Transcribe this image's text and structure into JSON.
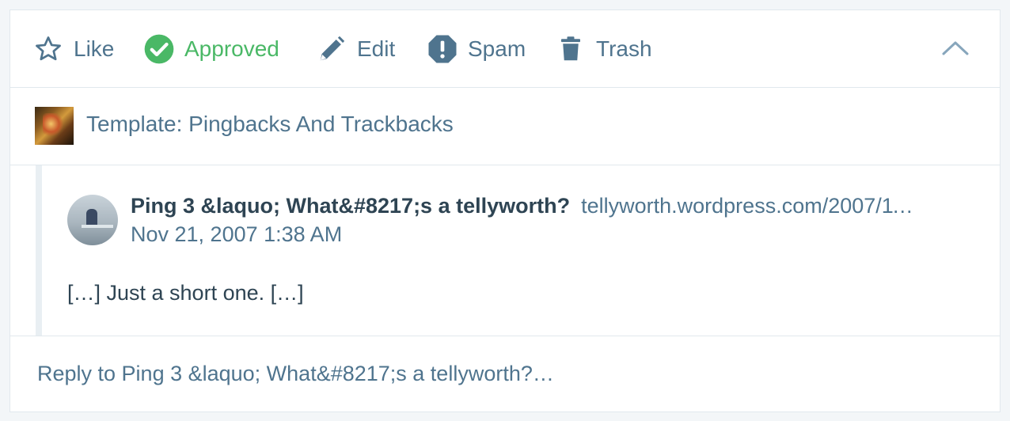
{
  "actions": {
    "like_label": "Like",
    "approved_label": "Approved",
    "edit_label": "Edit",
    "spam_label": "Spam",
    "trash_label": "Trash"
  },
  "site": {
    "title": "Template: Pingbacks And Trackbacks"
  },
  "comment": {
    "author": "Ping 3 &laquo; What&#8217;s a tellyworth?",
    "url": "tellyworth.wordpress.com/2007/11/21/ping-3/",
    "date": "Nov 21, 2007 1:38 AM",
    "body": "[…] Just a short one. […]"
  },
  "reply": {
    "label": "Reply to Ping 3 &laquo; What&#8217;s a tellyworth?…"
  },
  "colors": {
    "accent": "#4f748e",
    "approved": "#4ab866",
    "text": "#2e4453",
    "border": "#e1e8ed",
    "background": "#f3f6f8"
  }
}
